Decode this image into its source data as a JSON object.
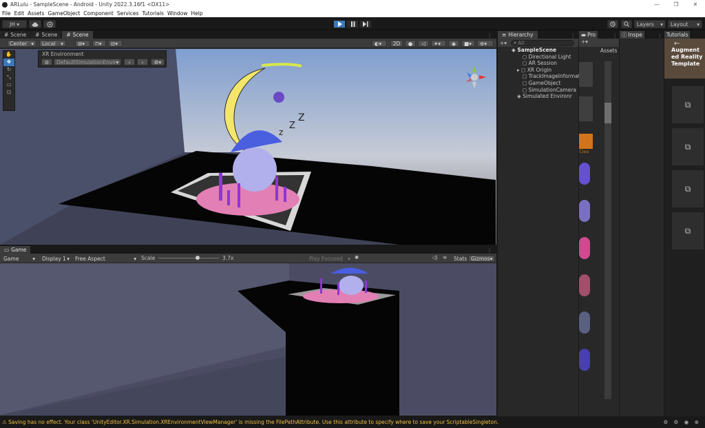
{
  "window": {
    "title": "ARLulu - SampleScene - Android - Unity 2022.3.16f1 <DX11>",
    "controls": [
      "—",
      "❐",
      "✕"
    ]
  },
  "menu": [
    "File",
    "Edit",
    "Assets",
    "GameObject",
    "Component",
    "Services",
    "Tutorials",
    "Window",
    "Help"
  ],
  "toolbar": {
    "account": "JH ▾",
    "cloud_icon": "cloud-icon",
    "collab_icon": "collab-icon",
    "layers": "Layers",
    "layout": "Layout"
  },
  "scene": {
    "tabs": [
      "Scene",
      "Scene",
      "Scene"
    ],
    "pivot": "Center",
    "space": "Local",
    "mode_2d": "2D",
    "overlay_title": "XR Environment",
    "environment": "DefaultSimulationEnvir"
  },
  "game": {
    "tab": "Game",
    "view": "Game",
    "display": "Display 1",
    "aspect": "Free Aspect",
    "scale_label": "Scale",
    "scale_value": "3.7x",
    "play_focused": "Play Focused",
    "stats": "Stats",
    "gizmos": "Gizmos"
  },
  "hierarchy": {
    "tab": "Hierarchy",
    "search_placeholder": "All",
    "scene": "SampleScene",
    "items": [
      "Directional Light",
      "AR Session",
      "XR Origin",
      "TrackImageInformat",
      "GameObject",
      "SimulationCamera"
    ],
    "env": "Simulated Environr"
  },
  "project": {
    "tab": "Pro",
    "assets": "Assets",
    "asset_label": "Clea"
  },
  "inspector": {
    "tab": "Inspe"
  },
  "tutorials": {
    "tab": "Tutorials",
    "title": "Augment ed Reality Template"
  },
  "status": {
    "message": "⚠ Saving has no effect. Your class 'UnityEditor.XR.Simulation.XREnvironmentViewManager' is missing the FilePathAttribute. Use this attribute to specify where to save your ScriptableSingleton."
  },
  "colors": {
    "accent": "#3a79bb",
    "warning": "#f0c040"
  }
}
